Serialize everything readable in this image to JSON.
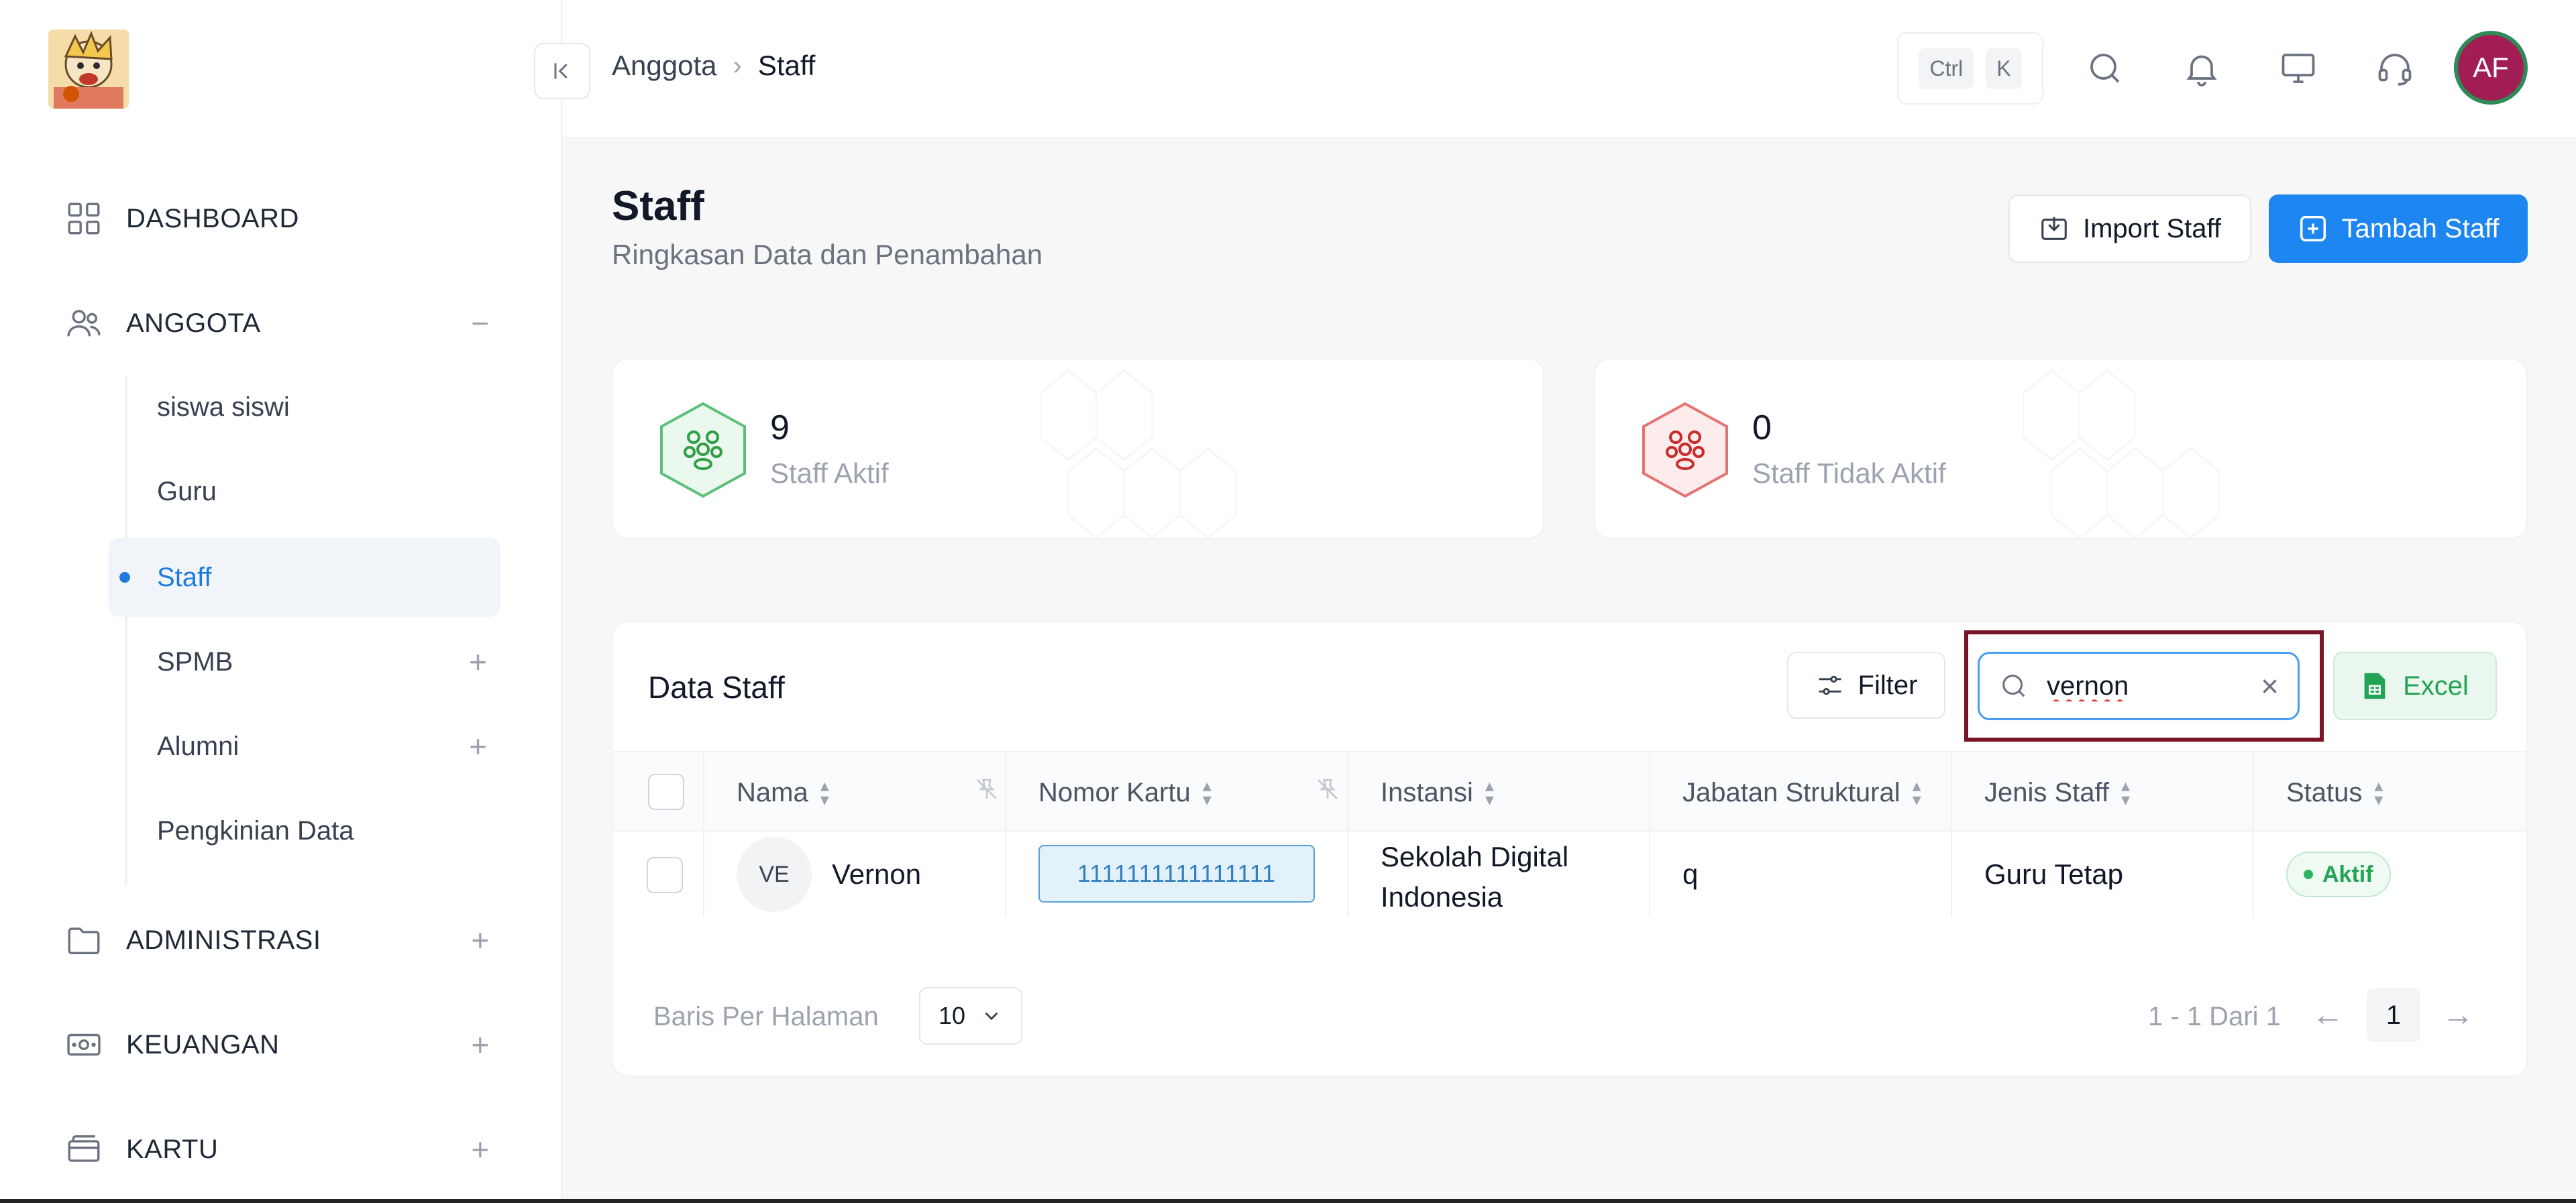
{
  "sidebar": {
    "items": [
      {
        "label": "DASHBOARD",
        "icon": "grid-icon"
      },
      {
        "label": "ANGGOTA",
        "icon": "users-icon",
        "toggle": "−"
      },
      {
        "label": "ADMINISTRASI",
        "icon": "folder-icon",
        "toggle": "+"
      },
      {
        "label": "KEUANGAN",
        "icon": "money-icon",
        "toggle": "+"
      },
      {
        "label": "KARTU",
        "icon": "card-icon",
        "toggle": "+"
      }
    ],
    "sub_items": [
      {
        "label": "siswa siswi"
      },
      {
        "label": "Guru"
      },
      {
        "label": "Staff"
      },
      {
        "label": "SPMB",
        "toggle": "+"
      },
      {
        "label": "Alumni",
        "toggle": "+"
      },
      {
        "label": "Pengkinian Data"
      }
    ]
  },
  "header": {
    "breadcrumb": [
      "Anggota",
      "Staff"
    ],
    "shortcut": [
      "Ctrl",
      "K"
    ],
    "avatar_initials": "AF"
  },
  "page": {
    "title": "Staff",
    "subtitle": "Ringkasan Data dan Penambahan",
    "import_label": "Import Staff",
    "add_label": "Tambah Staff"
  },
  "stats": [
    {
      "value": "9",
      "label": "Staff Aktif",
      "color": "#2f9e44"
    },
    {
      "value": "0",
      "label": "Staff Tidak Aktif",
      "color": "#c92a2a"
    }
  ],
  "table": {
    "title": "Data Staff",
    "filter_label": "Filter",
    "search_value": "vernon",
    "excel_label": "Excel",
    "columns": [
      "Nama",
      "Nomor Kartu",
      "Instansi",
      "Jabatan Struktural",
      "Jenis Staff",
      "Status"
    ],
    "rows": [
      {
        "initials": "VE",
        "nama": "Vernon",
        "nomor_kartu": "1111111111111111",
        "instansi": "Sekolah Digital Indonesia",
        "jabatan": "q",
        "jenis": "Guru Tetap",
        "status": "Aktif"
      }
    ],
    "rows_per_page_label": "Baris Per Halaman",
    "rows_per_page": "10",
    "page_info": "1 - 1 Dari 1",
    "current_page": "1"
  },
  "colors": {
    "accent": "#1d86f0",
    "active_text": "#1d7be0",
    "success": "#22a355",
    "focus_outline": "#7a1426"
  }
}
